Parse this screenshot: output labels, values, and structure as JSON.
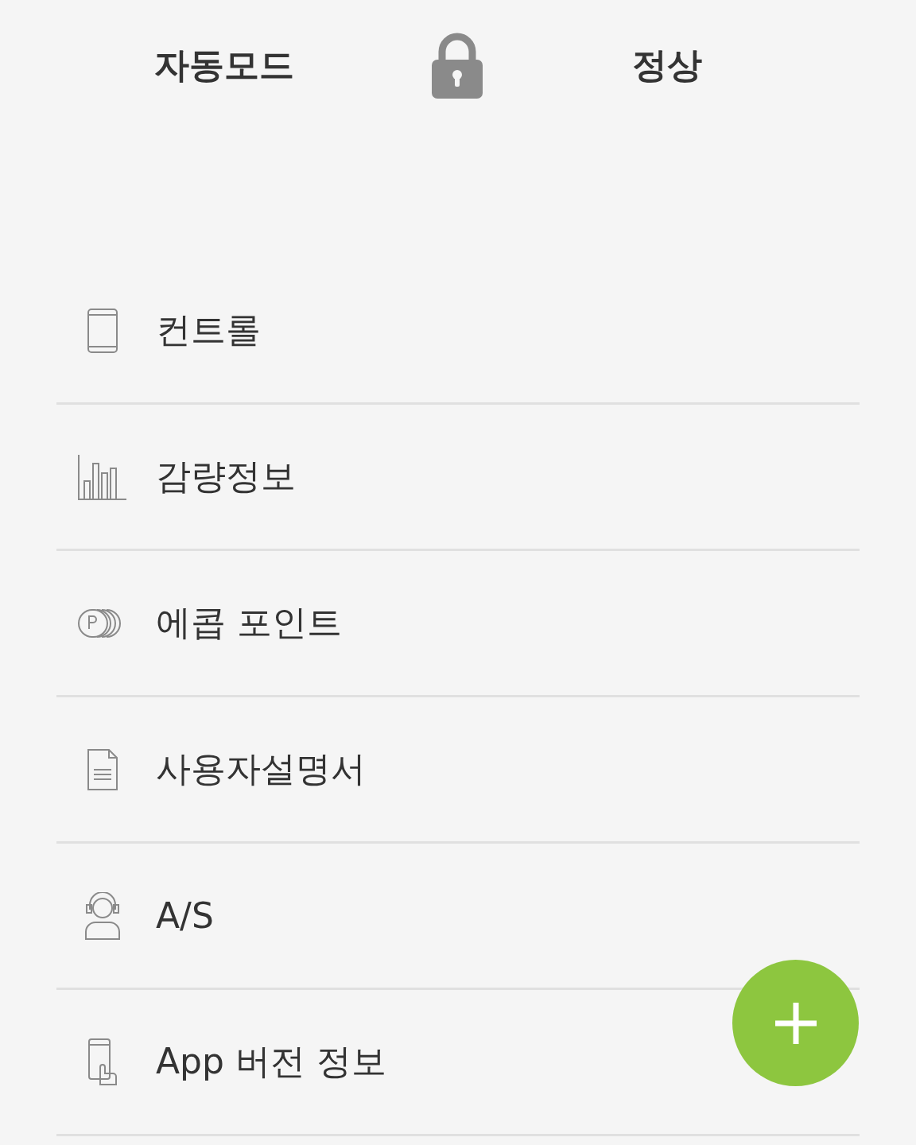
{
  "header": {
    "mode": "자동모드",
    "status": "정상"
  },
  "menu": [
    {
      "kind": "phone",
      "label": "컨트롤"
    },
    {
      "kind": "chart",
      "label": "감량정보"
    },
    {
      "kind": "coins",
      "label": "에콥 포인트"
    },
    {
      "kind": "document",
      "label": "사용자설명서"
    },
    {
      "kind": "support",
      "label": "A/S"
    },
    {
      "kind": "app",
      "label": "App 버전 정보"
    }
  ]
}
